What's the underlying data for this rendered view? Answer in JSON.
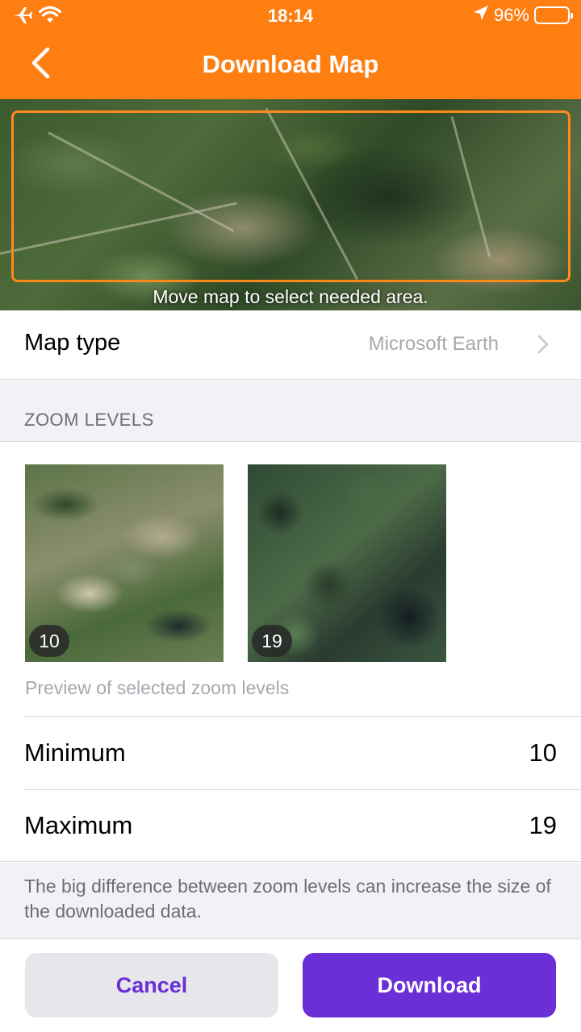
{
  "status_bar": {
    "time": "18:14",
    "battery_percent": "96%",
    "battery_level": 0.96,
    "icons": [
      "airplane-icon",
      "wifi-icon",
      "location-arrow-icon",
      "battery-icon"
    ]
  },
  "nav": {
    "title": "Download Map",
    "back_icon": "chevron-left-icon"
  },
  "map": {
    "hint": "Move map to select needed area."
  },
  "map_type": {
    "label": "Map type",
    "value": "Microsoft Earth"
  },
  "zoom": {
    "section_title": "ZOOM LEVELS",
    "previews": [
      {
        "level": "10"
      },
      {
        "level": "19"
      }
    ],
    "caption": "Preview of selected zoom levels",
    "minimum": {
      "label": "Minimum",
      "value": "10"
    },
    "maximum": {
      "label": "Maximum",
      "value": "19"
    }
  },
  "note": "The big difference between zoom levels can increase the size of the downloaded data.",
  "actions": {
    "cancel": "Cancel",
    "download": "Download"
  },
  "colors": {
    "header": "#ff7e12",
    "accent": "#6a2fd6",
    "selection": "#ff8a1a"
  }
}
